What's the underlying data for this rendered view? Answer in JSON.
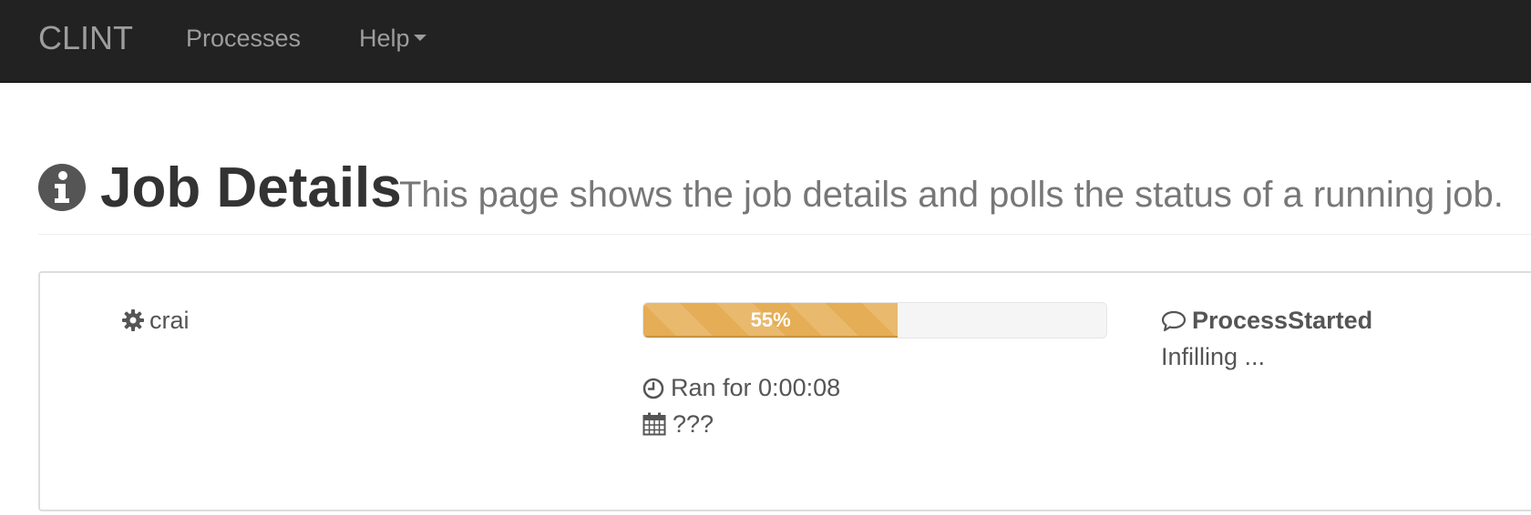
{
  "navbar": {
    "brand": "CLINT",
    "items": [
      {
        "label": "Processes"
      },
      {
        "label": "Help"
      }
    ]
  },
  "header": {
    "title": "Job Details",
    "subtitle": "This page shows the job details and polls the status of a running job."
  },
  "job": {
    "name": "crai",
    "progress_percent": 55,
    "progress_label": "55%",
    "run_time": "Ran for 0:00:08",
    "start_date": "???",
    "status": "ProcessStarted",
    "status_message": "Infilling ..."
  },
  "colors": {
    "navbar_bg": "#222222",
    "progress_warning": "#e5ad55"
  },
  "icons": {
    "header": "info-circle-icon",
    "job": "gear-icon",
    "run_time": "clock-icon",
    "start_date": "calendar-icon",
    "status": "comment-icon"
  }
}
